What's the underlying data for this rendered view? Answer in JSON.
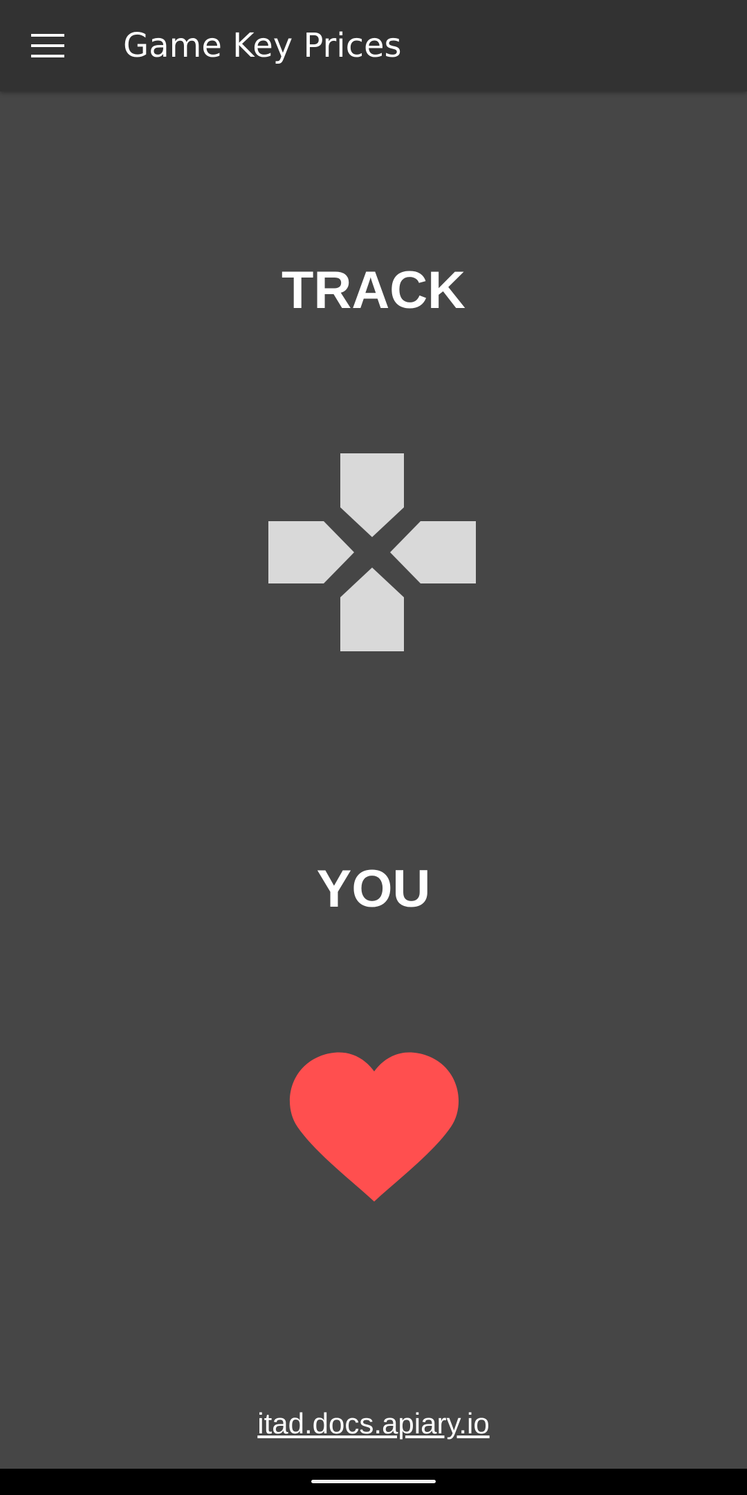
{
  "app_bar": {
    "title": "Game Key Prices",
    "menu_icon": "hamburger-menu-icon",
    "background": "#323232"
  },
  "main": {
    "headline_top": "TRACK",
    "headline_bottom": "YOU",
    "dpad_icon": "gamepad-dpad-icon",
    "dpad_color": "#d9d9d9",
    "heart_icon": "heart-icon",
    "heart_color": "#ff4f4f",
    "background": "#464646"
  },
  "footer": {
    "link_text": "itad.docs.apiary.io"
  },
  "system": {
    "nav_handle": "home-indicator"
  }
}
